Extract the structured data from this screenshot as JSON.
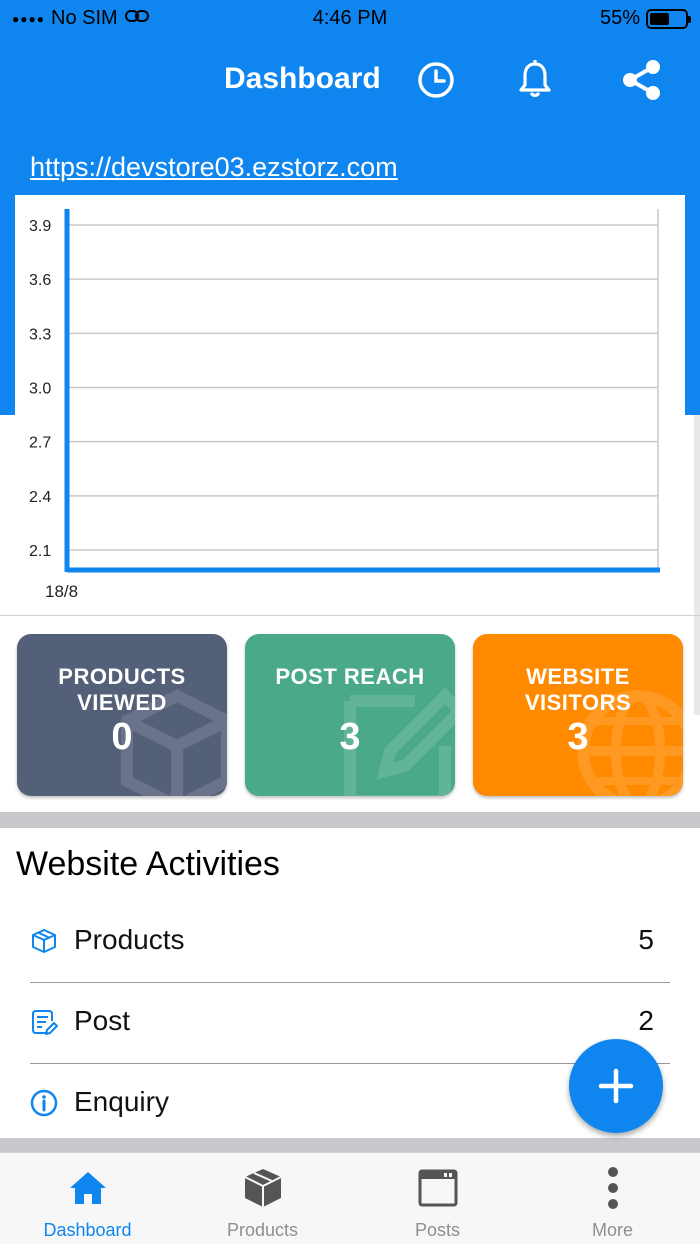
{
  "status_bar": {
    "carrier": "No SIM",
    "time": "4:46 PM",
    "battery": "55%",
    "battery_level": 0.55
  },
  "header": {
    "title": "Dashboard"
  },
  "store_url": "https://devstore03.ezstorz.com",
  "chart_data": {
    "type": "line",
    "x": [
      "18/8"
    ],
    "series": [
      {
        "values": []
      }
    ],
    "ylim": [
      2.1,
      3.9
    ],
    "yticks": [
      "3.9",
      "3.6",
      "3.3",
      "3.0",
      "2.7",
      "2.4",
      "2.1"
    ],
    "xticks": [
      "18/8"
    ],
    "grid": true,
    "colors": {
      "axis": "#0f86ef",
      "grid": "#c8c8c8"
    }
  },
  "stats": [
    {
      "label_line1": "PRODUCTS",
      "label_line2": "VIEWED",
      "value": "0",
      "color": "#545f78",
      "icon": "box-watermark-icon"
    },
    {
      "label_line1": "POST REACH",
      "label_line2": "",
      "value": "3",
      "color": "#4aa987",
      "icon": "edit-watermark-icon"
    },
    {
      "label_line1": "WEBSITE",
      "label_line2": "VISITORS",
      "value": "3",
      "color": "#ff8a00",
      "icon": "globe-watermark-icon"
    }
  ],
  "activities": {
    "title": "Website Activities",
    "items": [
      {
        "name": "Products",
        "count": "5",
        "icon": "box-icon"
      },
      {
        "name": "Post",
        "count": "2",
        "icon": "document-edit-icon"
      },
      {
        "name": "Enquiry",
        "count": "",
        "icon": "info-icon"
      }
    ]
  },
  "tabs": [
    {
      "label": "Dashboard",
      "icon": "home-icon",
      "active": true
    },
    {
      "label": "Products",
      "icon": "box-icon",
      "active": false
    },
    {
      "label": "Posts",
      "icon": "calendar-icon",
      "active": false
    },
    {
      "label": "More",
      "icon": "more-vertical-icon",
      "active": false
    }
  ],
  "colors": {
    "primary": "#0f86ef"
  }
}
